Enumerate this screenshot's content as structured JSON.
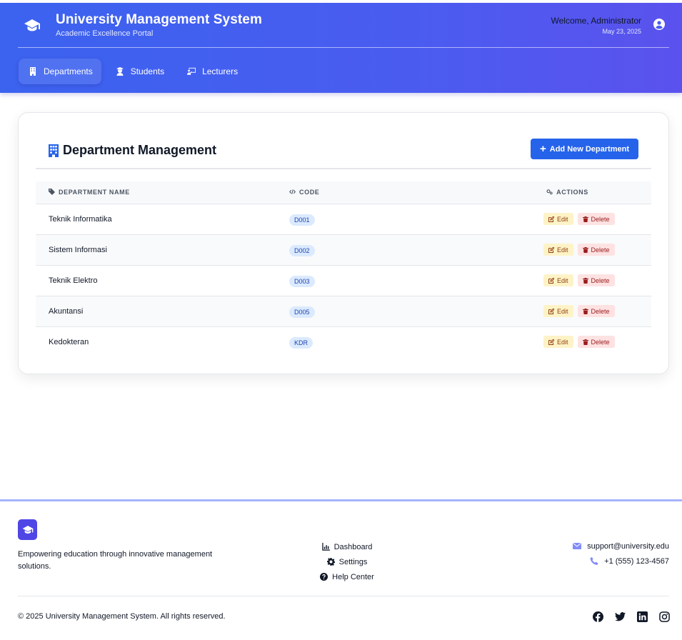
{
  "app": {
    "title": "University Management System",
    "subtitle": "Academic Excellence Portal",
    "brand_icon": "graduation-cap-icon"
  },
  "user": {
    "welcome": "Welcome, Administrator",
    "date": "May 23, 2025",
    "icon": "user-circle-icon"
  },
  "nav": {
    "tabs": [
      {
        "label": "Departments",
        "icon": "building-icon",
        "active": true
      },
      {
        "label": "Students",
        "icon": "student-icon",
        "active": false
      },
      {
        "label": "Lecturers",
        "icon": "chalkboard-teacher-icon",
        "active": false
      }
    ]
  },
  "panel": {
    "title": "Department Management",
    "title_icon": "building-icon",
    "add_button": "Add New Department"
  },
  "table": {
    "headers": {
      "name": "Department Name",
      "code": "Code",
      "actions": "Actions"
    },
    "rows": [
      {
        "name": "Teknik Informatika",
        "code": "D001"
      },
      {
        "name": "Sistem Informasi",
        "code": "D002"
      },
      {
        "name": "Teknik Elektro",
        "code": "D003"
      },
      {
        "name": "Akuntansi",
        "code": "D005"
      },
      {
        "name": "Kedokteran",
        "code": "KDR"
      }
    ],
    "edit_label": "Edit",
    "delete_label": "Delete"
  },
  "footer": {
    "tagline": "Empowering education through innovative management solutions.",
    "links": {
      "dashboard": "Dashboard",
      "settings": "Settings",
      "help": "Help Center"
    },
    "contact": {
      "email": "support@university.edu",
      "phone": "+1 (555) 123-4567"
    },
    "copyright": "© 2025 University Management System. All rights reserved.",
    "social": [
      "facebook-icon",
      "twitter-icon",
      "linkedin-icon",
      "instagram-icon"
    ]
  },
  "colors": {
    "header_start": "#3b63ef",
    "header_end": "#5b52ee",
    "primary": "#2563eb",
    "edit_bg": "#fef3c7",
    "delete_bg": "#fee2e2",
    "code_badge_bg": "#dbeafe"
  }
}
